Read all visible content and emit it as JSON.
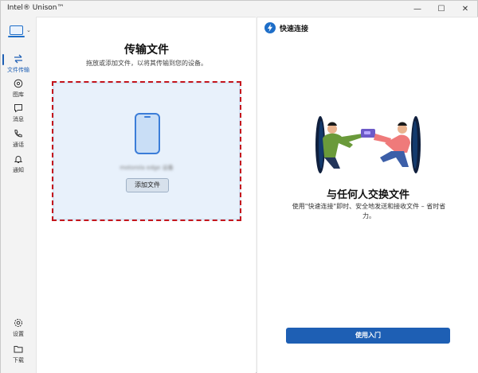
{
  "window": {
    "title": "Intel® Unison™",
    "controls": {
      "minimize": "—",
      "maximize": "☐",
      "close": "✕"
    }
  },
  "nav": {
    "device_switch_chevron": "⌄",
    "items": [
      {
        "id": "transfer",
        "label": "文件传输",
        "icon": "transfer-icon",
        "active": true
      },
      {
        "id": "gallery",
        "label": "图库",
        "icon": "gallery-icon",
        "active": false
      },
      {
        "id": "messages",
        "label": "消息",
        "icon": "message-icon",
        "active": false
      },
      {
        "id": "calls",
        "label": "通话",
        "icon": "phone-icon",
        "active": false
      },
      {
        "id": "notifications",
        "label": "通知",
        "icon": "bell-icon",
        "active": false
      }
    ],
    "bottom_items": [
      {
        "id": "settings",
        "label": "设置",
        "icon": "gear-icon"
      },
      {
        "id": "downloads",
        "label": "下载",
        "icon": "folder-icon"
      }
    ]
  },
  "transfer_panel": {
    "title": "传输文件",
    "subtitle": "拖放或添加文件，以将其传输到您的设备。",
    "device_name": "motorola edge 设备",
    "add_file_label": "添加文件"
  },
  "quick_connect": {
    "header_title": "快速连接",
    "title": "与任何人交换文件",
    "description": "使用\"快速连接\"即时、安全地发送和接收文件 – 省时省力。",
    "start_button": "使用入门"
  },
  "colors": {
    "accent": "#1e5fb4",
    "dropzone_bg": "#e8f1fb",
    "dropzone_border": "#c4151c"
  }
}
